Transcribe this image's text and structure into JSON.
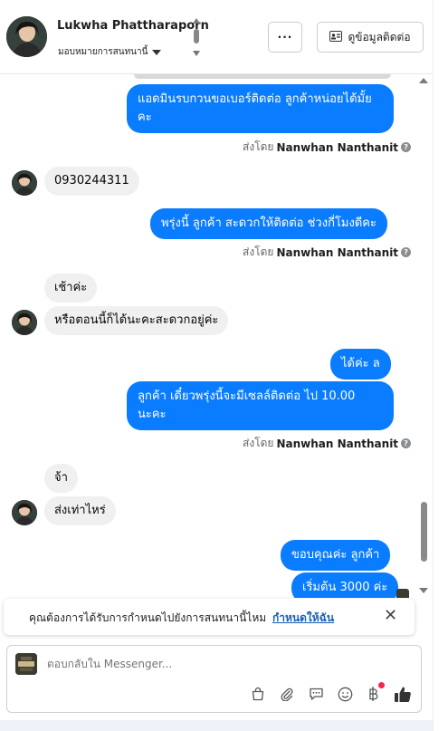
{
  "header": {
    "contact_name": "Lukwha Phattharaporn",
    "assign_label": "มอบหมายการสนทนานี้",
    "more_label": "···",
    "contact_info_label": "ดูข้อมูลติดต่อ"
  },
  "messages": {
    "m1": "แอดมินรบกวนขอเบอร์ติดต่อ ลูกค้าหน่อยได้มั้ยคะ",
    "m1_sentby_prefix": "ส่งโดย",
    "m1_sentby_name": "Nanwhan Nanthanit",
    "m2": "0930244311",
    "m3": "พรุ่งนี้ ลูกค้า สะดวกให้ติดต่อ ช่วงกี่โมงดีคะ",
    "m3_sentby_prefix": "ส่งโดย",
    "m3_sentby_name": "Nanwhan Nanthanit",
    "m4": "เช้าค่ะ",
    "m5": "หรือตอนนี้ก็ได้นะคะสะดวกอยู่ค่ะ",
    "m6": "ได้ค่ะ  ล",
    "m7": "ลูกค้า เดี๋ยวพรุ่งนี้จะมีเซลล์ติดต่อ ไป 10.00 นะคะ",
    "m7_sentby_prefix": "ส่งโดย",
    "m7_sentby_name": "Nanwhan Nanthanit",
    "m8": "จ้า",
    "m9": "ส่งเท่าไหร่",
    "m10": "ขอบคุณค่ะ  ลูกค้า",
    "m11": "เริ่มต้น 3000 ค่ะ"
  },
  "notice": {
    "text": "คุณต้องการได้รับการกำหนดไปยังการสนทนานี้ไหม",
    "link": "กำหนดให้ฉัน",
    "close": "✕"
  },
  "reply": {
    "placeholder": "ตอบกลับใน Messenger..."
  },
  "colors": {
    "outgoing_bubble": "#0a7cff",
    "incoming_bubble": "#f0f0f0",
    "link": "#1a5fb4"
  },
  "icons": [
    "bag-icon",
    "paperclip-icon",
    "chat-bubble-icon",
    "smiley-icon",
    "baht-icon",
    "thumbs-up-icon"
  ]
}
